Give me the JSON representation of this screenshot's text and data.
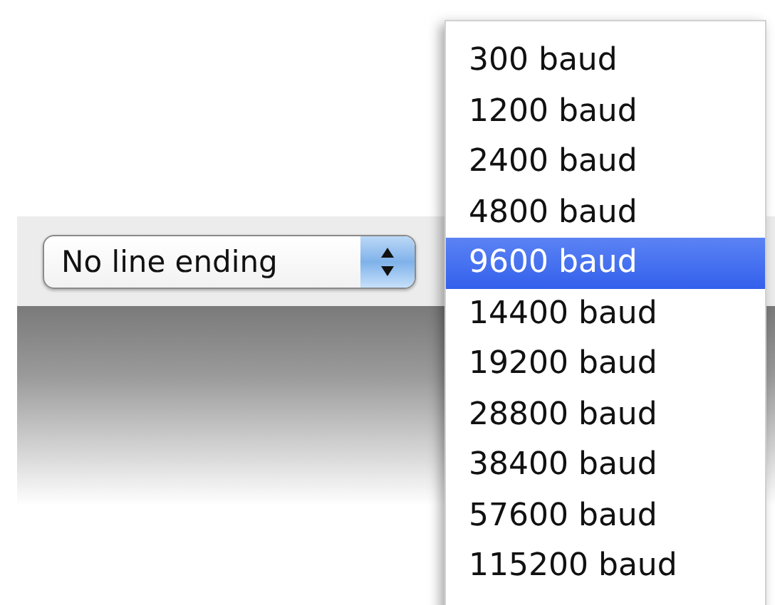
{
  "line_ending_select": {
    "value": "No line ending"
  },
  "baud_menu": {
    "items": [
      {
        "label": "300 baud",
        "selected": false
      },
      {
        "label": "1200 baud",
        "selected": false
      },
      {
        "label": "2400 baud",
        "selected": false
      },
      {
        "label": "4800 baud",
        "selected": false
      },
      {
        "label": "9600 baud",
        "selected": true
      },
      {
        "label": "14400 baud",
        "selected": false
      },
      {
        "label": "19200 baud",
        "selected": false
      },
      {
        "label": "28800 baud",
        "selected": false
      },
      {
        "label": "38400 baud",
        "selected": false
      },
      {
        "label": "57600 baud",
        "selected": false
      },
      {
        "label": "115200 baud",
        "selected": false
      }
    ]
  }
}
